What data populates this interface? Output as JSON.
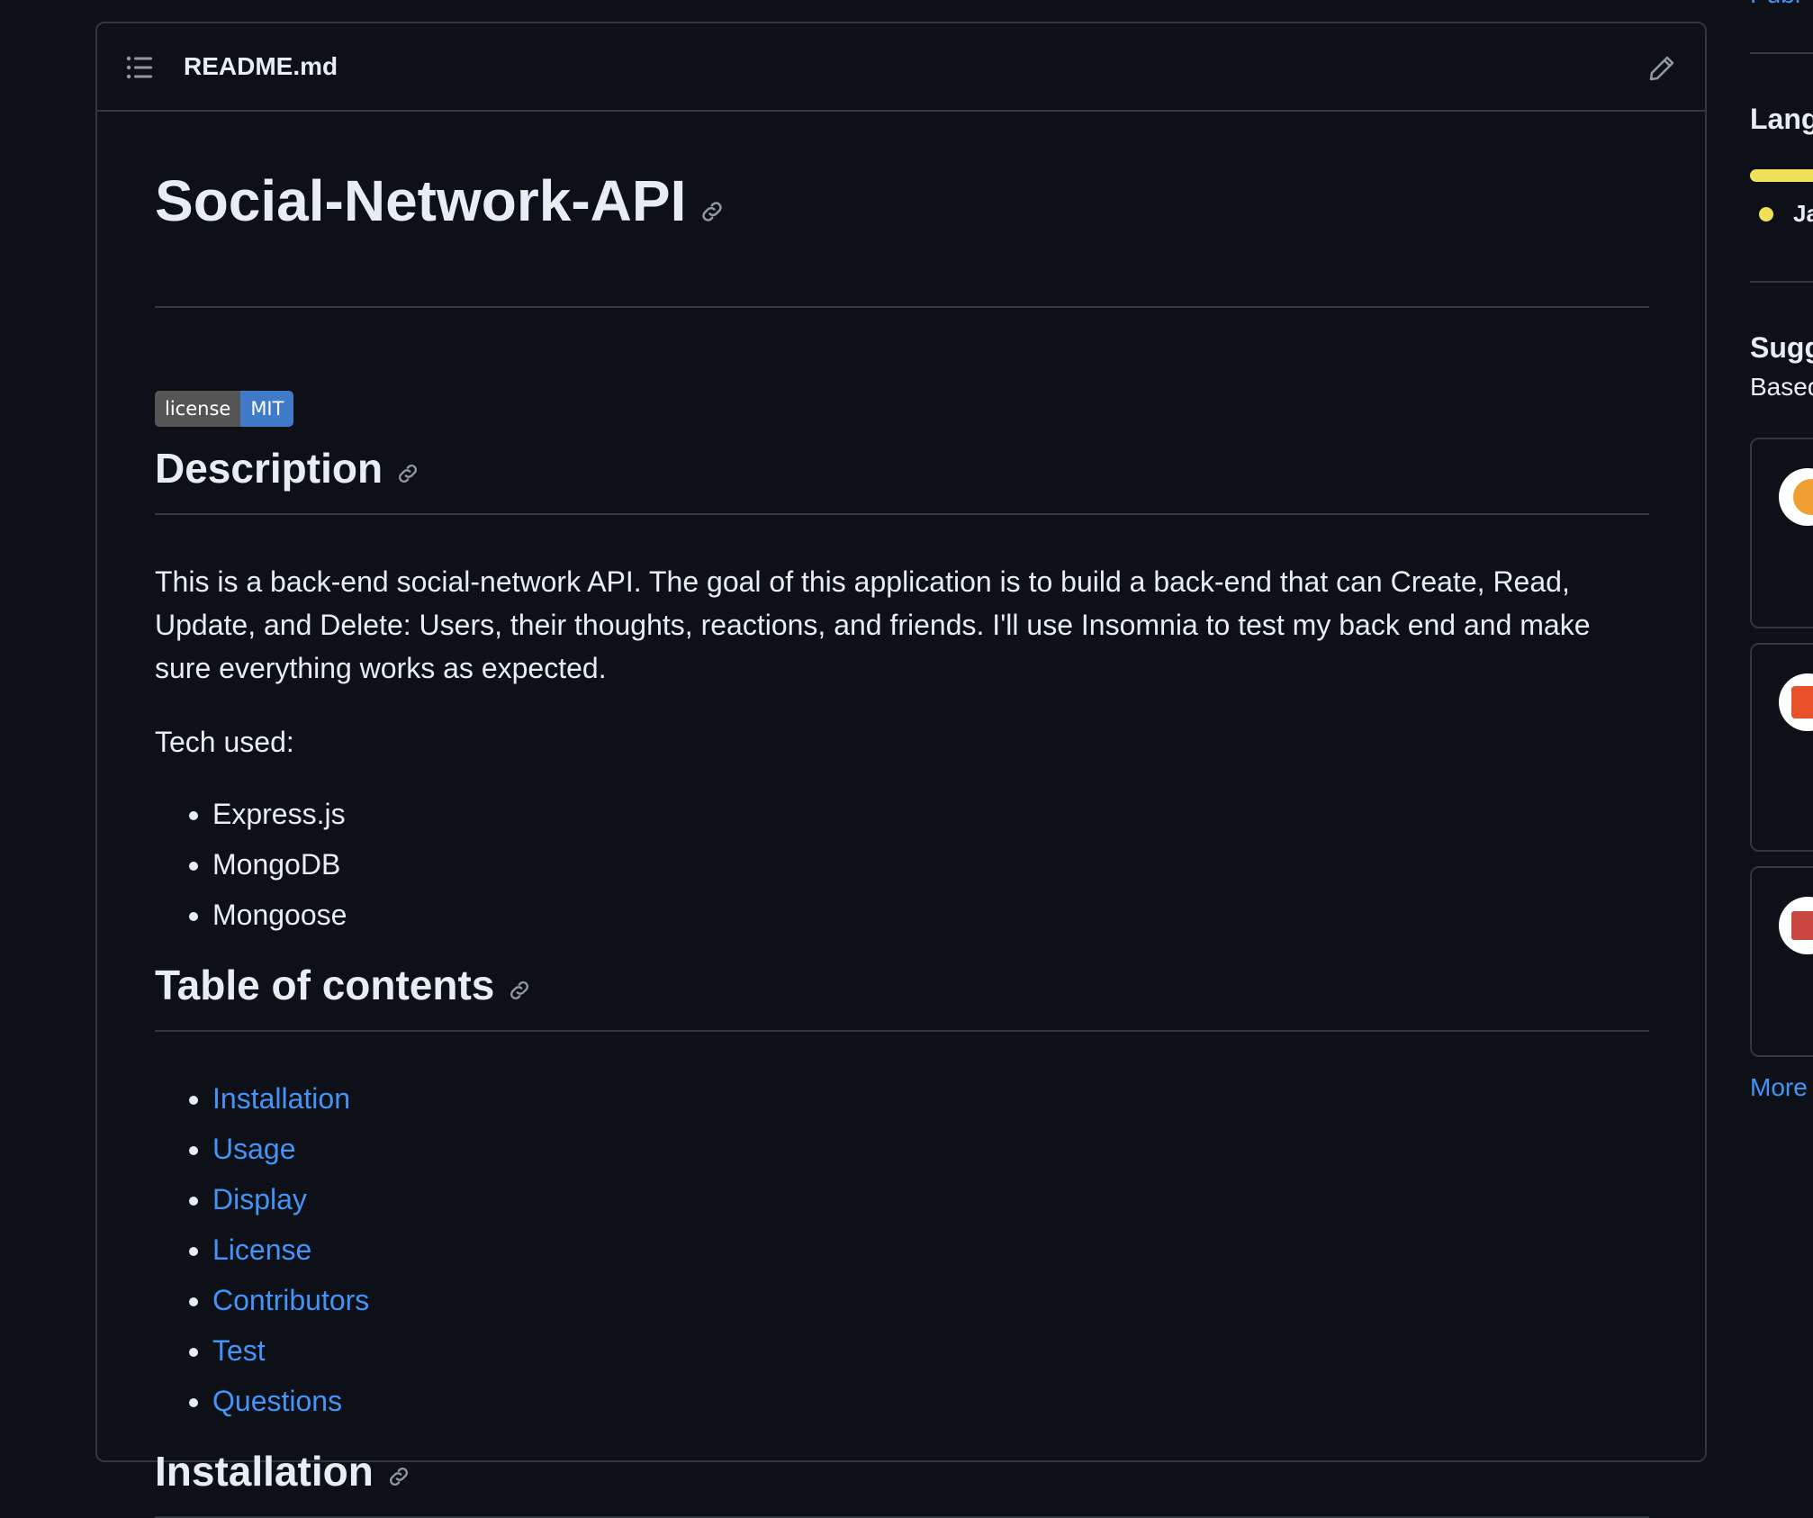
{
  "readme": {
    "filename": "README.md",
    "title": "Social-Network-API",
    "badge": {
      "label": "license",
      "value": "MIT"
    },
    "description_heading": "Description",
    "description_text": "This is a back-end social-network API. The goal of this application is to build a back-end that can Create, Read, Update, and Delete: Users, their thoughts, reactions, and friends. I'll use Insomnia to test my back end and make sure everything works as expected.",
    "tech_label": "Tech used:",
    "tech": [
      "Express.js",
      "MongoDB",
      "Mongoose"
    ],
    "toc_heading": "Table of contents",
    "toc": [
      "Installation",
      "Usage",
      "Display",
      "License",
      "Contributors",
      "Test",
      "Questions"
    ],
    "installation_heading": "Installation"
  },
  "sidebar": {
    "languages_heading": "Lang",
    "language_name": "Ja",
    "language_color": "#f1e05a",
    "suggested_heading": "Sugg",
    "suggested_sub": "Based",
    "more_link": "More"
  },
  "colors": {
    "background": "#0d1117",
    "border": "#30363d",
    "link": "#4493f8",
    "text": "#e6edf3"
  }
}
